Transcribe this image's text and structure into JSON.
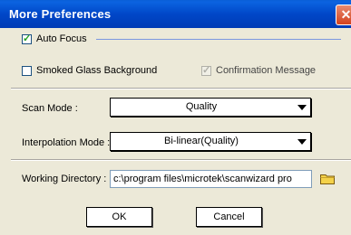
{
  "window": {
    "title": "More Preferences",
    "close_glyph": "✕"
  },
  "options": {
    "auto_focus": {
      "label": "Auto Focus",
      "checked": true
    },
    "smoked_glass": {
      "label": "Smoked Glass Background",
      "checked": false
    },
    "confirmation": {
      "label": "Confirmation Message",
      "checked": true,
      "disabled": true
    }
  },
  "scan_mode": {
    "label": "Scan Mode :",
    "value": "Quality"
  },
  "interpolation": {
    "label": "Interpolation Mode :",
    "value": "Bi-linear(Quality)"
  },
  "working_dir": {
    "label": "Working Directory :",
    "value": "c:\\program files\\microtek\\scanwizard pro"
  },
  "buttons": {
    "ok": "OK",
    "cancel": "Cancel"
  }
}
